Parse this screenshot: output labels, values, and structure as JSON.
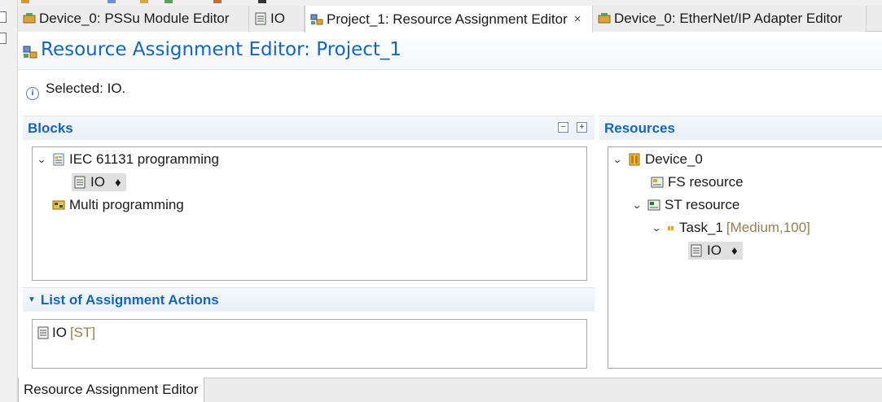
{
  "tabs": [
    {
      "label": "Device_0: PSSu Module Editor",
      "icon": "module-editor-icon",
      "active": false
    },
    {
      "label": "IO",
      "icon": "document-icon",
      "active": false
    },
    {
      "label": "Project_1: Resource Assignment Editor",
      "icon": "resource-assignment-icon",
      "active": true,
      "close": "×"
    },
    {
      "label": "Device_0: EtherNet/IP Adapter Editor",
      "icon": "adapter-editor-icon",
      "active": false
    }
  ],
  "editor": {
    "title": "Resource Assignment Editor: Project_1",
    "selected_info": "Selected: IO."
  },
  "blocks": {
    "heading": "Blocks",
    "items": [
      {
        "label": "IEC 61131 programming",
        "expanded": true
      },
      {
        "label": "IO",
        "marker": "♦",
        "selected": true
      },
      {
        "label": "Multi programming"
      }
    ],
    "collapse_all": "−",
    "expand_all": "+"
  },
  "actions": {
    "heading": "List of Assignment Actions",
    "items": [
      {
        "label": "IO",
        "tag": "[ST]"
      }
    ]
  },
  "resources": {
    "heading": "Resources",
    "items": [
      {
        "label": "Device_0"
      },
      {
        "label": "FS resource"
      },
      {
        "label": "ST resource"
      },
      {
        "label": "Task_1",
        "detail": "[Medium,100]"
      },
      {
        "label": "IO",
        "marker": "♦",
        "selected": true
      }
    ]
  },
  "bottom_tab": "Resource Assignment Editor",
  "colors": {
    "accent": "#1565c0",
    "muted_detail": "#9a7f52",
    "selection": "#e0e0e0"
  }
}
